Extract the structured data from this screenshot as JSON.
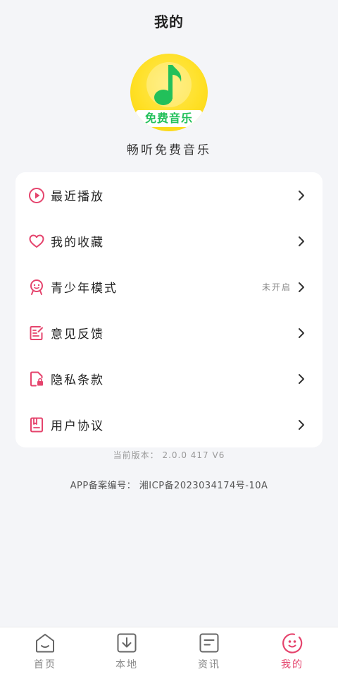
{
  "header": {
    "title": "我的"
  },
  "profile": {
    "logo_text": "免费音乐",
    "app_name": "畅听免费音乐"
  },
  "menu": {
    "items": [
      {
        "label": "最近播放",
        "icon": "play-circle-icon",
        "status": ""
      },
      {
        "label": "我的收藏",
        "icon": "heart-icon",
        "status": ""
      },
      {
        "label": "青少年模式",
        "icon": "youth-face-icon",
        "status": "未开启"
      },
      {
        "label": "意见反馈",
        "icon": "feedback-edit-icon",
        "status": ""
      },
      {
        "label": "隐私条款",
        "icon": "privacy-document-icon",
        "status": ""
      },
      {
        "label": "用户协议",
        "icon": "agreement-book-icon",
        "status": ""
      }
    ]
  },
  "footer": {
    "version": "当前版本： 2.0.0 417 V6",
    "icp": "APP备案编号：  湘ICP备2023034174号-10A"
  },
  "bottom_nav": {
    "tabs": [
      {
        "label": "首页",
        "icon": "home-icon",
        "active": false
      },
      {
        "label": "本地",
        "icon": "download-icon",
        "active": false
      },
      {
        "label": "资讯",
        "icon": "news-icon",
        "active": false
      },
      {
        "label": "我的",
        "icon": "smile-face-icon",
        "active": true
      }
    ]
  },
  "colors": {
    "accent": "#e5446d",
    "logo_yellow": "#ffe026",
    "logo_green": "#22c05a",
    "background": "#f4f5f8"
  }
}
